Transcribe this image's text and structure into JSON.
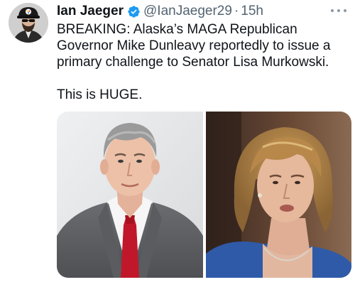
{
  "tweet": {
    "author": {
      "name": "Ian Jaeger",
      "handle": "@IanJaeger29",
      "separator": "·",
      "time": "15h",
      "avatar_icon": "profile-avatar",
      "verified_icon": "verified-badge-icon",
      "verified_color": "#1d9bf0"
    },
    "text": {
      "line1": "BREAKING: Alaska’s MAGA Republican",
      "line2": "Governor Mike Dunleavy reportedly to issue a",
      "line3": "primary challenge to Senator Lisa Murkowski.",
      "line4": "This is HUGE."
    },
    "more_icon": "more-options-icon",
    "media": {
      "photo_left": "portrait-man-red-tie",
      "photo_right": "portrait-woman-blond"
    }
  }
}
